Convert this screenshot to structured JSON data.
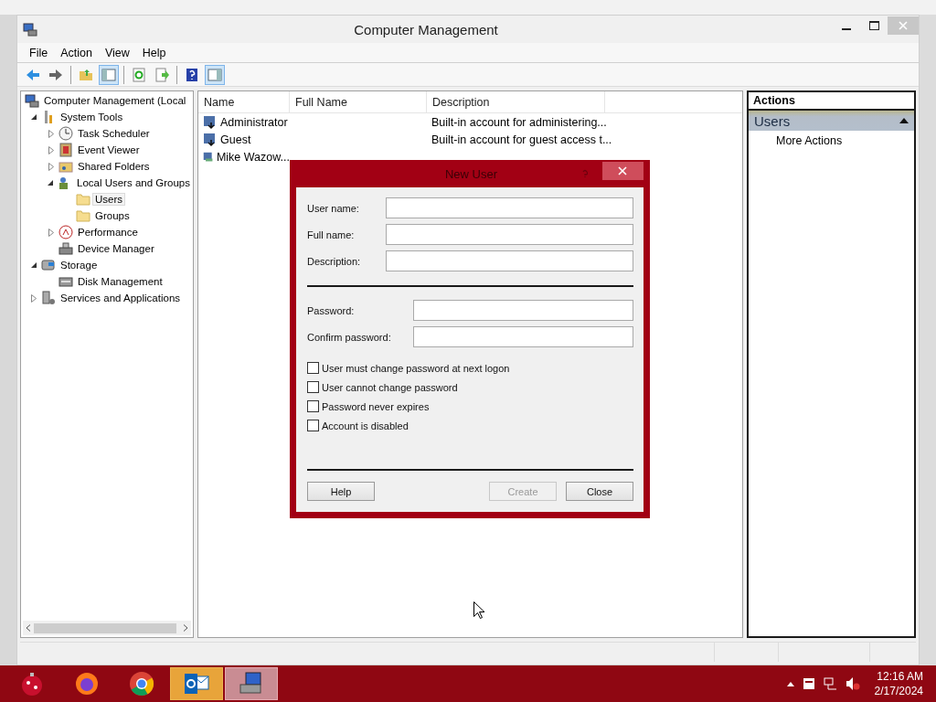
{
  "window": {
    "title": "Computer Management"
  },
  "menu": [
    "File",
    "Action",
    "View",
    "Help"
  ],
  "toolbar": [
    [
      {
        "kind": "back",
        "pressed": false
      },
      {
        "kind": "forward",
        "pressed": false
      }
    ],
    [
      {
        "kind": "up",
        "pressed": false
      },
      {
        "kind": "tree-toggle",
        "pressed": true
      }
    ],
    [
      {
        "kind": "refresh",
        "pressed": false
      },
      {
        "kind": "export",
        "pressed": false
      }
    ],
    [
      {
        "kind": "help",
        "pressed": false
      },
      {
        "kind": "pane-toggle",
        "pressed": true
      }
    ]
  ],
  "tree": [
    {
      "label": "Computer Management (Local",
      "kind": "computer",
      "selected": false,
      "children": [
        {
          "label": "System Tools",
          "kind": "tools",
          "expanded": true,
          "selected": false,
          "children": [
            {
              "label": "Task Scheduler",
              "kind": "clock",
              "expanded": false,
              "selected": false
            },
            {
              "label": "Event Viewer",
              "kind": "log",
              "expanded": false,
              "selected": false
            },
            {
              "label": "Shared Folders",
              "kind": "share",
              "expanded": false,
              "selected": false
            },
            {
              "label": "Local Users and Groups",
              "kind": "users",
              "expanded": true,
              "selected": false,
              "children": [
                {
                  "label": "Users",
                  "kind": "folder",
                  "selected": true
                },
                {
                  "label": "Groups",
                  "kind": "folder",
                  "selected": false
                }
              ]
            },
            {
              "label": "Performance",
              "kind": "gauge",
              "expanded": false,
              "selected": false
            },
            {
              "label": "Device Manager",
              "kind": "device",
              "selected": false
            }
          ]
        },
        {
          "label": "Storage",
          "kind": "storage",
          "expanded": true,
          "selected": false,
          "children": [
            {
              "label": "Disk Management",
              "kind": "disk",
              "selected": false
            }
          ]
        },
        {
          "label": "Services and Applications",
          "kind": "services",
          "expanded": false,
          "selected": false
        }
      ]
    }
  ],
  "list": {
    "columns": [
      "Name",
      "Full Name",
      "Description"
    ],
    "rows": [
      {
        "name": "Administrator",
        "kind": "builtin",
        "description": "Built-in account for administering..."
      },
      {
        "name": "Guest",
        "kind": "builtin",
        "description": "Built-in account for guest access t..."
      },
      {
        "name": "Mike Wazow...",
        "kind": "user"
      }
    ]
  },
  "actions": {
    "title": "Actions",
    "section": {
      "label": "Users",
      "expanded": true
    },
    "items": [
      {
        "label": "More Actions"
      }
    ]
  },
  "dialog": {
    "title": "New User",
    "identity_fields": [
      {
        "label": "User name:"
      },
      {
        "label": "Full name:"
      },
      {
        "label": "Description:"
      }
    ],
    "password_fields": [
      {
        "label": "Password:"
      },
      {
        "label": "Confirm password:"
      }
    ],
    "checkboxes": [
      {
        "label": "User must change password at next logon",
        "checked": false
      },
      {
        "label": "User cannot change password",
        "checked": false
      },
      {
        "label": "Password never expires",
        "checked": false
      },
      {
        "label": "Account is disabled",
        "checked": false
      }
    ],
    "buttons": [
      {
        "label": "Help",
        "disabled": false
      },
      {
        "label": "Create",
        "disabled": true
      },
      {
        "label": "Close",
        "disabled": false
      }
    ]
  },
  "taskbar": {
    "apps": [
      {
        "kind": "orb",
        "active": false
      },
      {
        "kind": "firefox",
        "active": false
      },
      {
        "kind": "chrome",
        "active": false
      },
      {
        "kind": "outlook",
        "active": false
      },
      {
        "kind": "management",
        "active": true
      }
    ],
    "clock": {
      "time": "12:16 AM",
      "date": "2/17/2024"
    }
  }
}
